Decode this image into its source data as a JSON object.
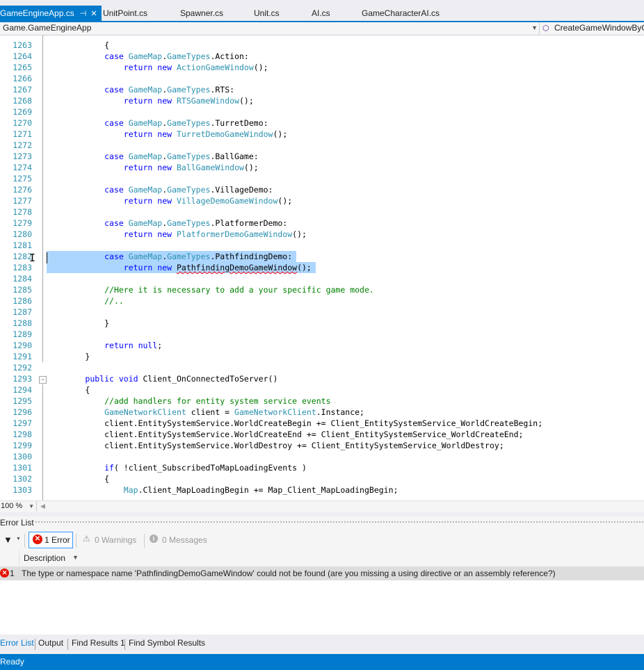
{
  "tabs": [
    {
      "label": "GameEngineApp.cs",
      "active": true
    },
    {
      "label": "UnitPoint.cs"
    },
    {
      "label": "Spawner.cs"
    },
    {
      "label": "Unit.cs"
    },
    {
      "label": "AI.cs"
    },
    {
      "label": "GameCharacterAI.cs"
    }
  ],
  "tab_pin_glyph": "⊣",
  "tab_close_glyph": "✕",
  "navbar": {
    "type_dropdown": "Game.GameEngineApp",
    "member_dropdown": "CreateGameWindowByGameType"
  },
  "editor": {
    "lines": [
      {
        "n": "1263",
        "tokens": [
          {
            "t": "            {"
          }
        ]
      },
      {
        "n": "1264",
        "tokens": [
          {
            "t": "            "
          },
          {
            "t": "case",
            "c": "kw"
          },
          {
            "t": " "
          },
          {
            "t": "GameMap",
            "c": "ty"
          },
          {
            "t": "."
          },
          {
            "t": "GameTypes",
            "c": "ty"
          },
          {
            "t": ".Action:"
          }
        ]
      },
      {
        "n": "1265",
        "tokens": [
          {
            "t": "                "
          },
          {
            "t": "return",
            "c": "kw"
          },
          {
            "t": " "
          },
          {
            "t": "new",
            "c": "kw"
          },
          {
            "t": " "
          },
          {
            "t": "ActionGameWindow",
            "c": "ty"
          },
          {
            "t": "();"
          }
        ]
      },
      {
        "n": "1266",
        "tokens": []
      },
      {
        "n": "1267",
        "tokens": [
          {
            "t": "            "
          },
          {
            "t": "case",
            "c": "kw"
          },
          {
            "t": " "
          },
          {
            "t": "GameMap",
            "c": "ty"
          },
          {
            "t": "."
          },
          {
            "t": "GameTypes",
            "c": "ty"
          },
          {
            "t": ".RTS:"
          }
        ]
      },
      {
        "n": "1268",
        "tokens": [
          {
            "t": "                "
          },
          {
            "t": "return",
            "c": "kw"
          },
          {
            "t": " "
          },
          {
            "t": "new",
            "c": "kw"
          },
          {
            "t": " "
          },
          {
            "t": "RTSGameWindow",
            "c": "ty"
          },
          {
            "t": "();"
          }
        ]
      },
      {
        "n": "1269",
        "tokens": []
      },
      {
        "n": "1270",
        "tokens": [
          {
            "t": "            "
          },
          {
            "t": "case",
            "c": "kw"
          },
          {
            "t": " "
          },
          {
            "t": "GameMap",
            "c": "ty"
          },
          {
            "t": "."
          },
          {
            "t": "GameTypes",
            "c": "ty"
          },
          {
            "t": ".TurretDemo:"
          }
        ]
      },
      {
        "n": "1271",
        "tokens": [
          {
            "t": "                "
          },
          {
            "t": "return",
            "c": "kw"
          },
          {
            "t": " "
          },
          {
            "t": "new",
            "c": "kw"
          },
          {
            "t": " "
          },
          {
            "t": "TurretDemoGameWindow",
            "c": "ty"
          },
          {
            "t": "();"
          }
        ]
      },
      {
        "n": "1272",
        "tokens": []
      },
      {
        "n": "1273",
        "tokens": [
          {
            "t": "            "
          },
          {
            "t": "case",
            "c": "kw"
          },
          {
            "t": " "
          },
          {
            "t": "GameMap",
            "c": "ty"
          },
          {
            "t": "."
          },
          {
            "t": "GameTypes",
            "c": "ty"
          },
          {
            "t": ".BallGame:"
          }
        ]
      },
      {
        "n": "1274",
        "tokens": [
          {
            "t": "                "
          },
          {
            "t": "return",
            "c": "kw"
          },
          {
            "t": " "
          },
          {
            "t": "new",
            "c": "kw"
          },
          {
            "t": " "
          },
          {
            "t": "BallGameWindow",
            "c": "ty"
          },
          {
            "t": "();"
          }
        ]
      },
      {
        "n": "1275",
        "tokens": []
      },
      {
        "n": "1276",
        "tokens": [
          {
            "t": "            "
          },
          {
            "t": "case",
            "c": "kw"
          },
          {
            "t": " "
          },
          {
            "t": "GameMap",
            "c": "ty"
          },
          {
            "t": "."
          },
          {
            "t": "GameTypes",
            "c": "ty"
          },
          {
            "t": ".VillageDemo:"
          }
        ]
      },
      {
        "n": "1277",
        "tokens": [
          {
            "t": "                "
          },
          {
            "t": "return",
            "c": "kw"
          },
          {
            "t": " "
          },
          {
            "t": "new",
            "c": "kw"
          },
          {
            "t": " "
          },
          {
            "t": "VillageDemoGameWindow",
            "c": "ty"
          },
          {
            "t": "();"
          }
        ]
      },
      {
        "n": "1278",
        "tokens": []
      },
      {
        "n": "1279",
        "tokens": [
          {
            "t": "            "
          },
          {
            "t": "case",
            "c": "kw"
          },
          {
            "t": " "
          },
          {
            "t": "GameMap",
            "c": "ty"
          },
          {
            "t": "."
          },
          {
            "t": "GameTypes",
            "c": "ty"
          },
          {
            "t": ".PlatformerDemo:"
          }
        ]
      },
      {
        "n": "1280",
        "tokens": [
          {
            "t": "                "
          },
          {
            "t": "return",
            "c": "kw"
          },
          {
            "t": " "
          },
          {
            "t": "new",
            "c": "kw"
          },
          {
            "t": " "
          },
          {
            "t": "PlatformerDemoGameWindow",
            "c": "ty"
          },
          {
            "t": "();"
          }
        ]
      },
      {
        "n": "1281",
        "tokens": []
      },
      {
        "n": "1282",
        "selected": true,
        "tokens": [
          {
            "t": "            "
          },
          {
            "t": "case",
            "c": "kw"
          },
          {
            "t": " "
          },
          {
            "t": "GameMap",
            "c": "ty"
          },
          {
            "t": "."
          },
          {
            "t": "GameTypes",
            "c": "ty"
          },
          {
            "t": ".PathfindingDemo:"
          }
        ]
      },
      {
        "n": "1283",
        "selected": true,
        "tokens": [
          {
            "t": "                "
          },
          {
            "t": "return",
            "c": "kw"
          },
          {
            "t": " "
          },
          {
            "t": "new",
            "c": "kw"
          },
          {
            "t": " "
          },
          {
            "t": "PathfindingDemoGameWindow",
            "squig": true
          },
          {
            "t": "();"
          }
        ]
      },
      {
        "n": "1284",
        "tokens": []
      },
      {
        "n": "1285",
        "tokens": [
          {
            "t": "            "
          },
          {
            "t": "//Here it is necessary to add a your specific game mode.",
            "c": "cm"
          }
        ]
      },
      {
        "n": "1286",
        "tokens": [
          {
            "t": "            "
          },
          {
            "t": "//..",
            "c": "cm"
          }
        ]
      },
      {
        "n": "1287",
        "tokens": []
      },
      {
        "n": "1288",
        "tokens": [
          {
            "t": "            }"
          }
        ]
      },
      {
        "n": "1289",
        "tokens": []
      },
      {
        "n": "1290",
        "tokens": [
          {
            "t": "            "
          },
          {
            "t": "return",
            "c": "kw"
          },
          {
            "t": " "
          },
          {
            "t": "null",
            "c": "kw"
          },
          {
            "t": ";"
          }
        ]
      },
      {
        "n": "1291",
        "tokens": [
          {
            "t": "        }"
          }
        ]
      },
      {
        "n": "1292",
        "tokens": []
      },
      {
        "n": "1293",
        "tokens": [
          {
            "t": "        "
          },
          {
            "t": "public",
            "c": "kw"
          },
          {
            "t": " "
          },
          {
            "t": "void",
            "c": "kw"
          },
          {
            "t": " Client_OnConnectedToServer()"
          }
        ]
      },
      {
        "n": "1294",
        "tokens": [
          {
            "t": "        {"
          }
        ]
      },
      {
        "n": "1295",
        "tokens": [
          {
            "t": "            "
          },
          {
            "t": "//add handlers for entity system service events",
            "c": "cm"
          }
        ]
      },
      {
        "n": "1296",
        "tokens": [
          {
            "t": "            "
          },
          {
            "t": "GameNetworkClient",
            "c": "ty"
          },
          {
            "t": " client = "
          },
          {
            "t": "GameNetworkClient",
            "c": "ty"
          },
          {
            "t": ".Instance;"
          }
        ]
      },
      {
        "n": "1297",
        "tokens": [
          {
            "t": "            client.EntitySystemService.WorldCreateBegin += Client_EntitySystemService_WorldCreateBegin;"
          }
        ]
      },
      {
        "n": "1298",
        "tokens": [
          {
            "t": "            client.EntitySystemService.WorldCreateEnd += Client_EntitySystemService_WorldCreateEnd;"
          }
        ]
      },
      {
        "n": "1299",
        "tokens": [
          {
            "t": "            client.EntitySystemService.WorldDestroy += Client_EntitySystemService_WorldDestroy;"
          }
        ]
      },
      {
        "n": "1300",
        "tokens": []
      },
      {
        "n": "1301",
        "tokens": [
          {
            "t": "            "
          },
          {
            "t": "if",
            "c": "kw"
          },
          {
            "t": "( !client_SubscribedToMapLoadingEvents )"
          }
        ]
      },
      {
        "n": "1302",
        "tokens": [
          {
            "t": "            {"
          }
        ]
      },
      {
        "n": "1303",
        "tokens": [
          {
            "t": "                "
          },
          {
            "t": "Map",
            "c": "ty"
          },
          {
            "t": ".Client_MapLoadingBegin += Map_Client_MapLoadingBegin;"
          }
        ]
      }
    ]
  },
  "zoom": "100 %",
  "error_list": {
    "title": "Error List",
    "errors_label": "1 Error",
    "warnings_label": "0 Warnings",
    "messages_label": "0 Messages",
    "column_description": "Description",
    "rows": [
      {
        "num": "1",
        "description": "The type or namespace name 'PathfindingDemoGameWindow' could not be found (are you missing a using directive or an assembly reference?)"
      }
    ]
  },
  "tool_tabs": [
    "Error List",
    "Output",
    "Find Results 1",
    "Find Symbol Results"
  ],
  "status": "Ready",
  "colors": {
    "accent": "#007acc",
    "selection": "#add6ff",
    "keyword": "#0000ff",
    "type": "#2b91af",
    "comment": "#008000",
    "error": "#e51400"
  }
}
